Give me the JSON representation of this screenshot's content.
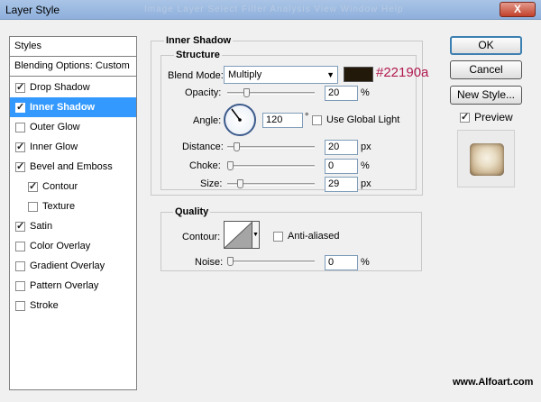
{
  "window": {
    "title": "Layer Style",
    "close_label": "X",
    "menu_ghost": "Image   Layer   Select   Filter   Analysis   View   Window   Help"
  },
  "sidebar": {
    "header": "Styles",
    "blending": "Blending Options: Custom",
    "items": [
      {
        "label": "Drop Shadow",
        "checked": true
      },
      {
        "label": "Inner Shadow",
        "checked": true,
        "selected": true
      },
      {
        "label": "Outer Glow",
        "checked": false
      },
      {
        "label": "Inner Glow",
        "checked": true
      },
      {
        "label": "Bevel and Emboss",
        "checked": true
      },
      {
        "label": "Contour",
        "checked": true,
        "indent": true
      },
      {
        "label": "Texture",
        "checked": false,
        "indent": true
      },
      {
        "label": "Satin",
        "checked": true
      },
      {
        "label": "Color Overlay",
        "checked": false
      },
      {
        "label": "Gradient Overlay",
        "checked": false
      },
      {
        "label": "Pattern Overlay",
        "checked": false
      },
      {
        "label": "Stroke",
        "checked": false
      }
    ]
  },
  "inner_shadow": {
    "title": "Inner Shadow",
    "structure_title": "Structure",
    "blend_mode_label": "Blend Mode:",
    "blend_mode_value": "Multiply",
    "color_hex": "#22190a",
    "color_label": "#22190a",
    "opacity_label": "Opacity:",
    "opacity_value": "20",
    "opacity_unit": "%",
    "opacity_level": 0.2,
    "angle_label": "Angle:",
    "angle_value": "120",
    "angle_unit": "°",
    "use_global_light_label": "Use Global Light",
    "use_global_light": false,
    "distance_label": "Distance:",
    "distance_value": "20",
    "distance_unit": "px",
    "distance_level": 0.08,
    "choke_label": "Choke:",
    "choke_value": "0",
    "choke_unit": "%",
    "choke_level": 0.0,
    "size_label": "Size:",
    "size_value": "29",
    "size_unit": "px",
    "size_level": 0.12
  },
  "quality": {
    "title": "Quality",
    "contour_label": "Contour:",
    "anti_aliased_label": "Anti-aliased",
    "anti_aliased": false,
    "noise_label": "Noise:",
    "noise_value": "0",
    "noise_unit": "%",
    "noise_level": 0.0
  },
  "buttons": {
    "ok": "OK",
    "cancel": "Cancel",
    "new_style": "New Style...",
    "preview_label": "Preview",
    "preview_checked": true
  },
  "watermark": "www.Alfoart.com"
}
